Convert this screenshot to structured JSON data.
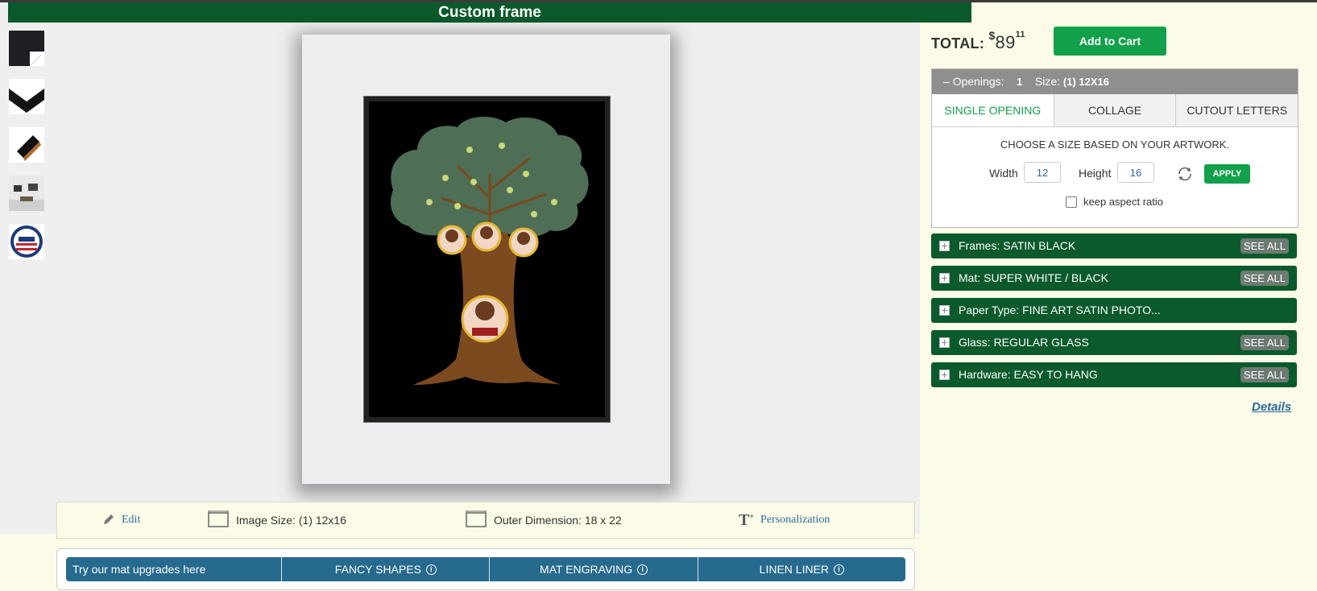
{
  "header": {
    "title": "Custom frame"
  },
  "thumbnails": [
    "corner-thumb",
    "profile-thumb",
    "side-thumb",
    "room-thumb",
    "made-in-usa-thumb"
  ],
  "info_bar": {
    "edit": "Edit",
    "image_size": "Image Size: (1) 12x16",
    "outer_dimension": "Outer Dimension: 18 x 22",
    "personalization": "Personalization"
  },
  "upgrades": {
    "intro": "Try our mat upgrades here",
    "items": [
      "FANCY SHAPES",
      "MAT ENGRAVING",
      "LINEN LINER"
    ]
  },
  "order": {
    "total_label": "TOTAL:",
    "currency": "$",
    "price_whole": "89",
    "price_cents": "11",
    "add_to_cart": "Add to Cart"
  },
  "openings": {
    "header_label": "Openings:",
    "count": "1",
    "size_label": "Size:",
    "size_value": "(1) 12X16",
    "tabs": [
      "SINGLE OPENING",
      "COLLAGE",
      "CUTOUT LETTERS"
    ],
    "active_tab": "SINGLE OPENING",
    "instruction": "CHOOSE A SIZE BASED ON YOUR ARTWORK.",
    "width_label": "Width",
    "width_value": "12",
    "height_label": "Height",
    "height_value": "16",
    "apply": "APPLY",
    "keep_aspect": "keep aspect ratio"
  },
  "options": [
    {
      "label": "Frames: SATIN BLACK",
      "see_all": "SEE ALL"
    },
    {
      "label": "Mat: SUPER WHITE / BLACK",
      "see_all": "SEE ALL"
    },
    {
      "label": "Paper Type: FINE ART SATIN PHOTO...",
      "see_all": ""
    },
    {
      "label": "Glass: REGULAR GLASS",
      "see_all": "SEE ALL"
    },
    {
      "label": "Hardware: EASY TO HANG",
      "see_all": "SEE ALL"
    }
  ],
  "details": "Details",
  "colors": {
    "header_green": "#0b5a2c",
    "cta_green": "#12a14a",
    "upgrade_blue": "#266a8e",
    "link_blue": "#2a6aa0"
  }
}
